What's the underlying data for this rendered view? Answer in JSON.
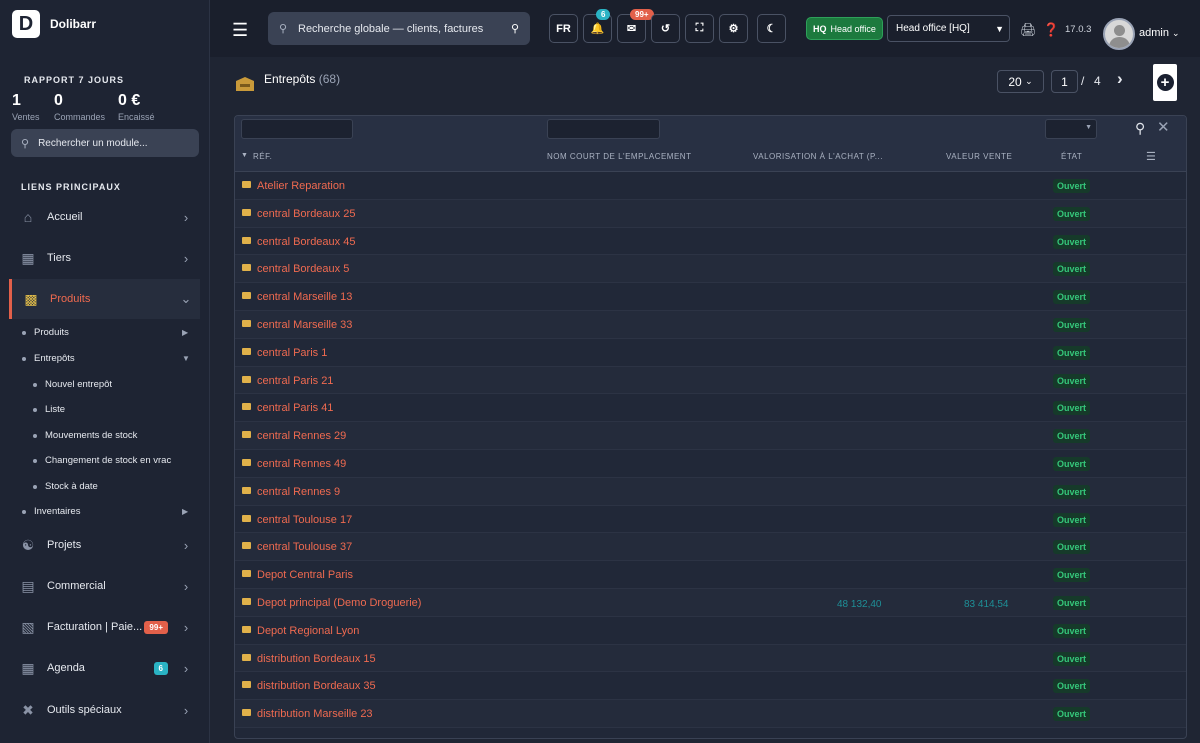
{
  "brand": {
    "logo_letter": "D",
    "name": "Dolibarr"
  },
  "report": {
    "title": "RAPPORT 7 JOURS",
    "stats": [
      {
        "value": "1",
        "label": "Ventes"
      },
      {
        "value": "0",
        "label": "Commandes"
      },
      {
        "value": "0 €",
        "label": "Encaissé"
      }
    ]
  },
  "module_search": {
    "placeholder": "Rechercher un module..."
  },
  "main_links_title": "LIENS PRINCIPAUX",
  "menu": [
    {
      "label": "Accueil",
      "icon": "home-icon"
    },
    {
      "label": "Tiers",
      "icon": "building-icon"
    },
    {
      "label": "Produits",
      "icon": "box-icon",
      "active": true
    },
    {
      "label": "Projets",
      "icon": "project-icon"
    },
    {
      "label": "Commercial",
      "icon": "suitcase-icon"
    },
    {
      "label": "Facturation | Paie...",
      "icon": "invoice-icon",
      "badge": "99+",
      "badge_color": "#e2604a"
    },
    {
      "label": "Agenda",
      "icon": "calendar-icon",
      "badge": "6",
      "badge_color": "#2ab3c4"
    },
    {
      "label": "Outils spéciaux",
      "icon": "tools-icon"
    }
  ],
  "submenu": [
    "Produits",
    "Entrepôts",
    "Nouvel entrepôt",
    "Liste",
    "Mouvements de stock",
    "Changement de stock en vrac",
    "Stock à date",
    "Inventaires"
  ],
  "topbar": {
    "search_placeholder": "Recherche globale — clients, factures",
    "lang": "FR",
    "notif_count": "6",
    "mail_count": "99+",
    "entity_badge": "HQ",
    "entity_name": "Head office",
    "entity_select": "Head office [HQ]",
    "version": "17.0.3",
    "user": "admin"
  },
  "page": {
    "title": "Entrepôts",
    "count": "(68)",
    "page_size": "20",
    "page": "1",
    "page_sep": "/",
    "page_total": "4"
  },
  "columns": [
    "RÉF.",
    "NOM COURT DE L'EMPLACEMENT",
    "VALORISATION À L'ACHAT (P...",
    "VALEUR VENTE",
    "ÉTAT"
  ],
  "rows": [
    {
      "ref": "Atelier Reparation",
      "purchase": "",
      "sale": "",
      "status": "Ouvert"
    },
    {
      "ref": "central Bordeaux 25",
      "purchase": "",
      "sale": "",
      "status": "Ouvert"
    },
    {
      "ref": "central Bordeaux 45",
      "purchase": "",
      "sale": "",
      "status": "Ouvert"
    },
    {
      "ref": "central Bordeaux 5",
      "purchase": "",
      "sale": "",
      "status": "Ouvert"
    },
    {
      "ref": "central Marseille 13",
      "purchase": "",
      "sale": "",
      "status": "Ouvert"
    },
    {
      "ref": "central Marseille 33",
      "purchase": "",
      "sale": "",
      "status": "Ouvert"
    },
    {
      "ref": "central Paris 1",
      "purchase": "",
      "sale": "",
      "status": "Ouvert"
    },
    {
      "ref": "central Paris 21",
      "purchase": "",
      "sale": "",
      "status": "Ouvert"
    },
    {
      "ref": "central Paris 41",
      "purchase": "",
      "sale": "",
      "status": "Ouvert"
    },
    {
      "ref": "central Rennes 29",
      "purchase": "",
      "sale": "",
      "status": "Ouvert"
    },
    {
      "ref": "central Rennes 49",
      "purchase": "",
      "sale": "",
      "status": "Ouvert"
    },
    {
      "ref": "central Rennes 9",
      "purchase": "",
      "sale": "",
      "status": "Ouvert"
    },
    {
      "ref": "central Toulouse 17",
      "purchase": "",
      "sale": "",
      "status": "Ouvert"
    },
    {
      "ref": "central Toulouse 37",
      "purchase": "",
      "sale": "",
      "status": "Ouvert"
    },
    {
      "ref": "Depot Central Paris",
      "purchase": "",
      "sale": "",
      "status": "Ouvert"
    },
    {
      "ref": "Depot principal (Demo Droguerie)",
      "purchase": "48 132,40",
      "sale": "83 414,54",
      "status": "Ouvert"
    },
    {
      "ref": "Depot Regional Lyon",
      "purchase": "",
      "sale": "",
      "status": "Ouvert"
    },
    {
      "ref": "distribution Bordeaux 15",
      "purchase": "",
      "sale": "",
      "status": "Ouvert"
    },
    {
      "ref": "distribution Bordeaux 35",
      "purchase": "",
      "sale": "",
      "status": "Ouvert"
    },
    {
      "ref": "distribution Marseille 23",
      "purchase": "",
      "sale": "",
      "status": "Ouvert"
    }
  ]
}
